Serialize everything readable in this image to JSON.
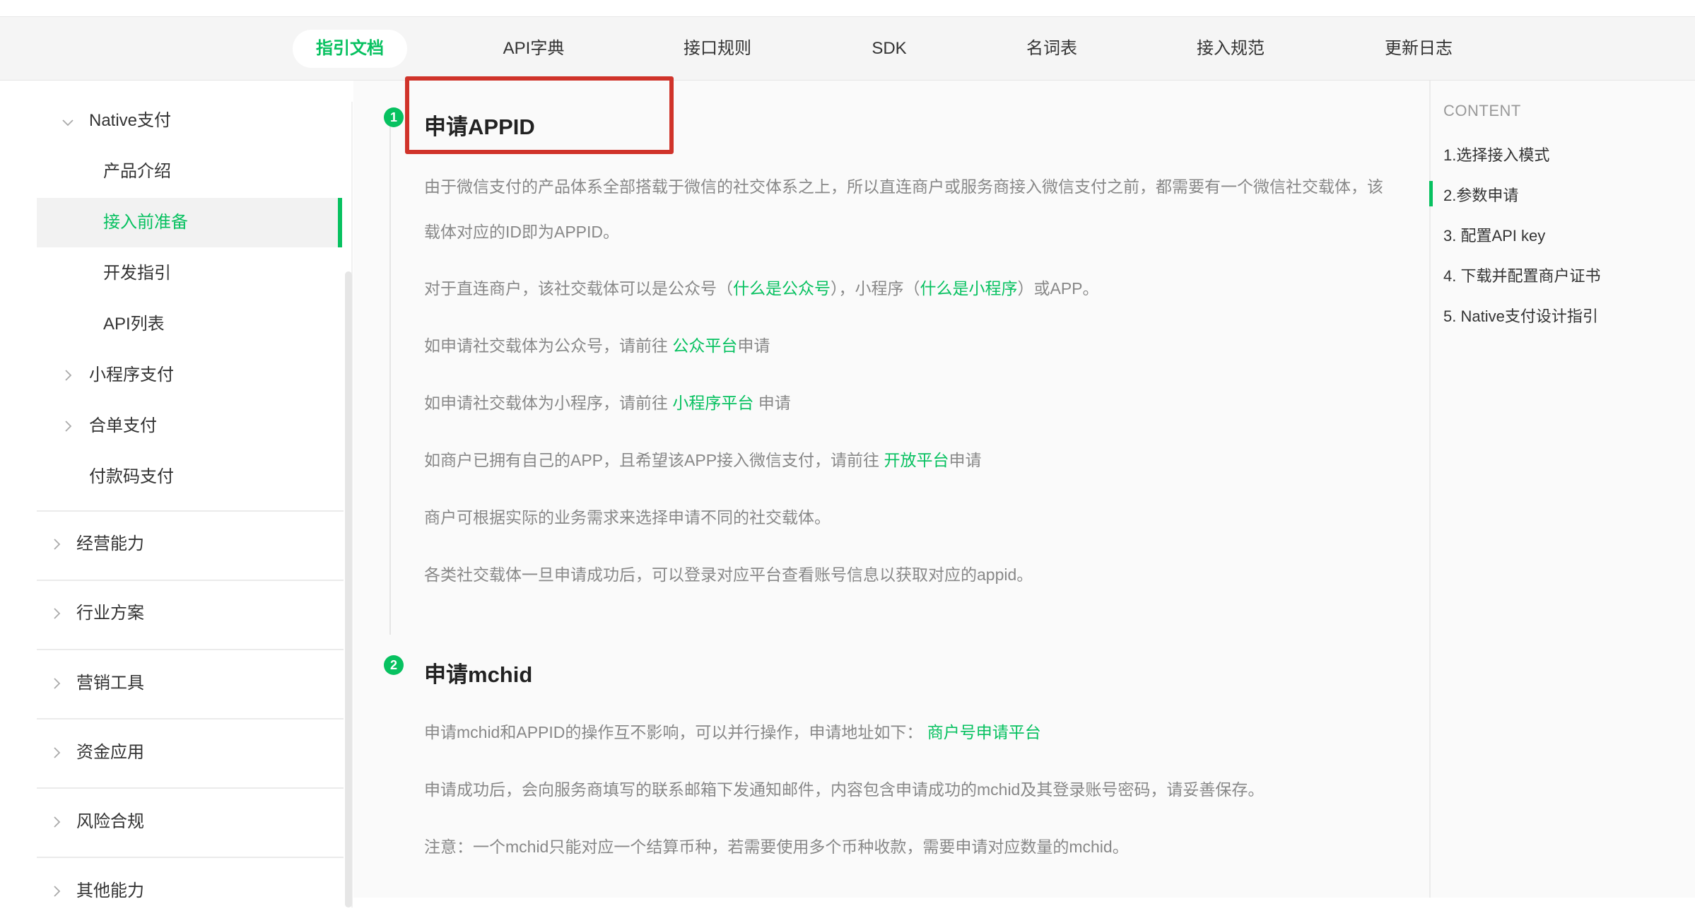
{
  "nav": {
    "items": [
      {
        "label": "指引文档",
        "active": true
      },
      {
        "label": "API字典"
      },
      {
        "label": "接口规则"
      },
      {
        "label": "SDK"
      },
      {
        "label": "名词表"
      },
      {
        "label": "接入规范"
      },
      {
        "label": "更新日志"
      }
    ]
  },
  "sidebar": {
    "native": "Native支付",
    "native_children": [
      "产品介绍",
      "接入前准备",
      "开发指引",
      "API列表"
    ],
    "mini": "小程序支付",
    "combine": "合单支付",
    "paycode": "付款码支付",
    "groups": [
      "经营能力",
      "行业方案",
      "营销工具",
      "资金应用",
      "风险合规",
      "其他能力"
    ]
  },
  "content": {
    "sec1": {
      "step": "1",
      "title": "申请APPID",
      "p1": "由于微信支付的产品体系全部搭载于微信的社交体系之上，所以直连商户或服务商接入微信支付之前，都需要有一个微信社交载体，该载体对应的ID即为APPID。",
      "p2_pre": "对于直连商户，该社交载体可以是公众号（",
      "p2_link1": "什么是公众号",
      "p2_mid": "），小程序（",
      "p2_link2": "什么是小程序",
      "p2_post": "）或APP。",
      "p3_pre": "如申请社交载体为公众号，请前往 ",
      "p3_link": "公众平台",
      "p3_post": "申请",
      "p4_pre": "如申请社交载体为小程序，请前往 ",
      "p4_link": "小程序平台",
      "p4_post": " 申请",
      "p5_pre": "如商户已拥有自己的APP，且希望该APP接入微信支付，请前往 ",
      "p5_link": "开放平台",
      "p5_post": "申请",
      "p6": "商户可根据实际的业务需求来选择申请不同的社交载体。",
      "p7": "各类社交载体一旦申请成功后，可以登录对应平台查看账号信息以获取对应的appid。"
    },
    "sec2": {
      "step": "2",
      "title": "申请mchid",
      "p1_pre": "申请mchid和APPID的操作互不影响，可以并行操作，申请地址如下：  ",
      "p1_link": "商户号申请平台",
      "p2": "申请成功后，会向服务商填写的联系邮箱下发通知邮件，内容包含申请成功的mchid及其登录账号密码，请妥善保存。",
      "p3": "注意：一个mchid只能对应一个结算币种，若需要使用多个币种收款，需要申请对应数量的mchid。"
    }
  },
  "toc": {
    "head": "CONTENT",
    "items": [
      "1.选择接入模式",
      "2.参数申请",
      "3. 配置API key",
      "4. 下载并配置商户证书",
      "5. Native支付设计指引"
    ]
  },
  "colors": {
    "accent": "#07c160",
    "highlight": "#d0332a"
  }
}
